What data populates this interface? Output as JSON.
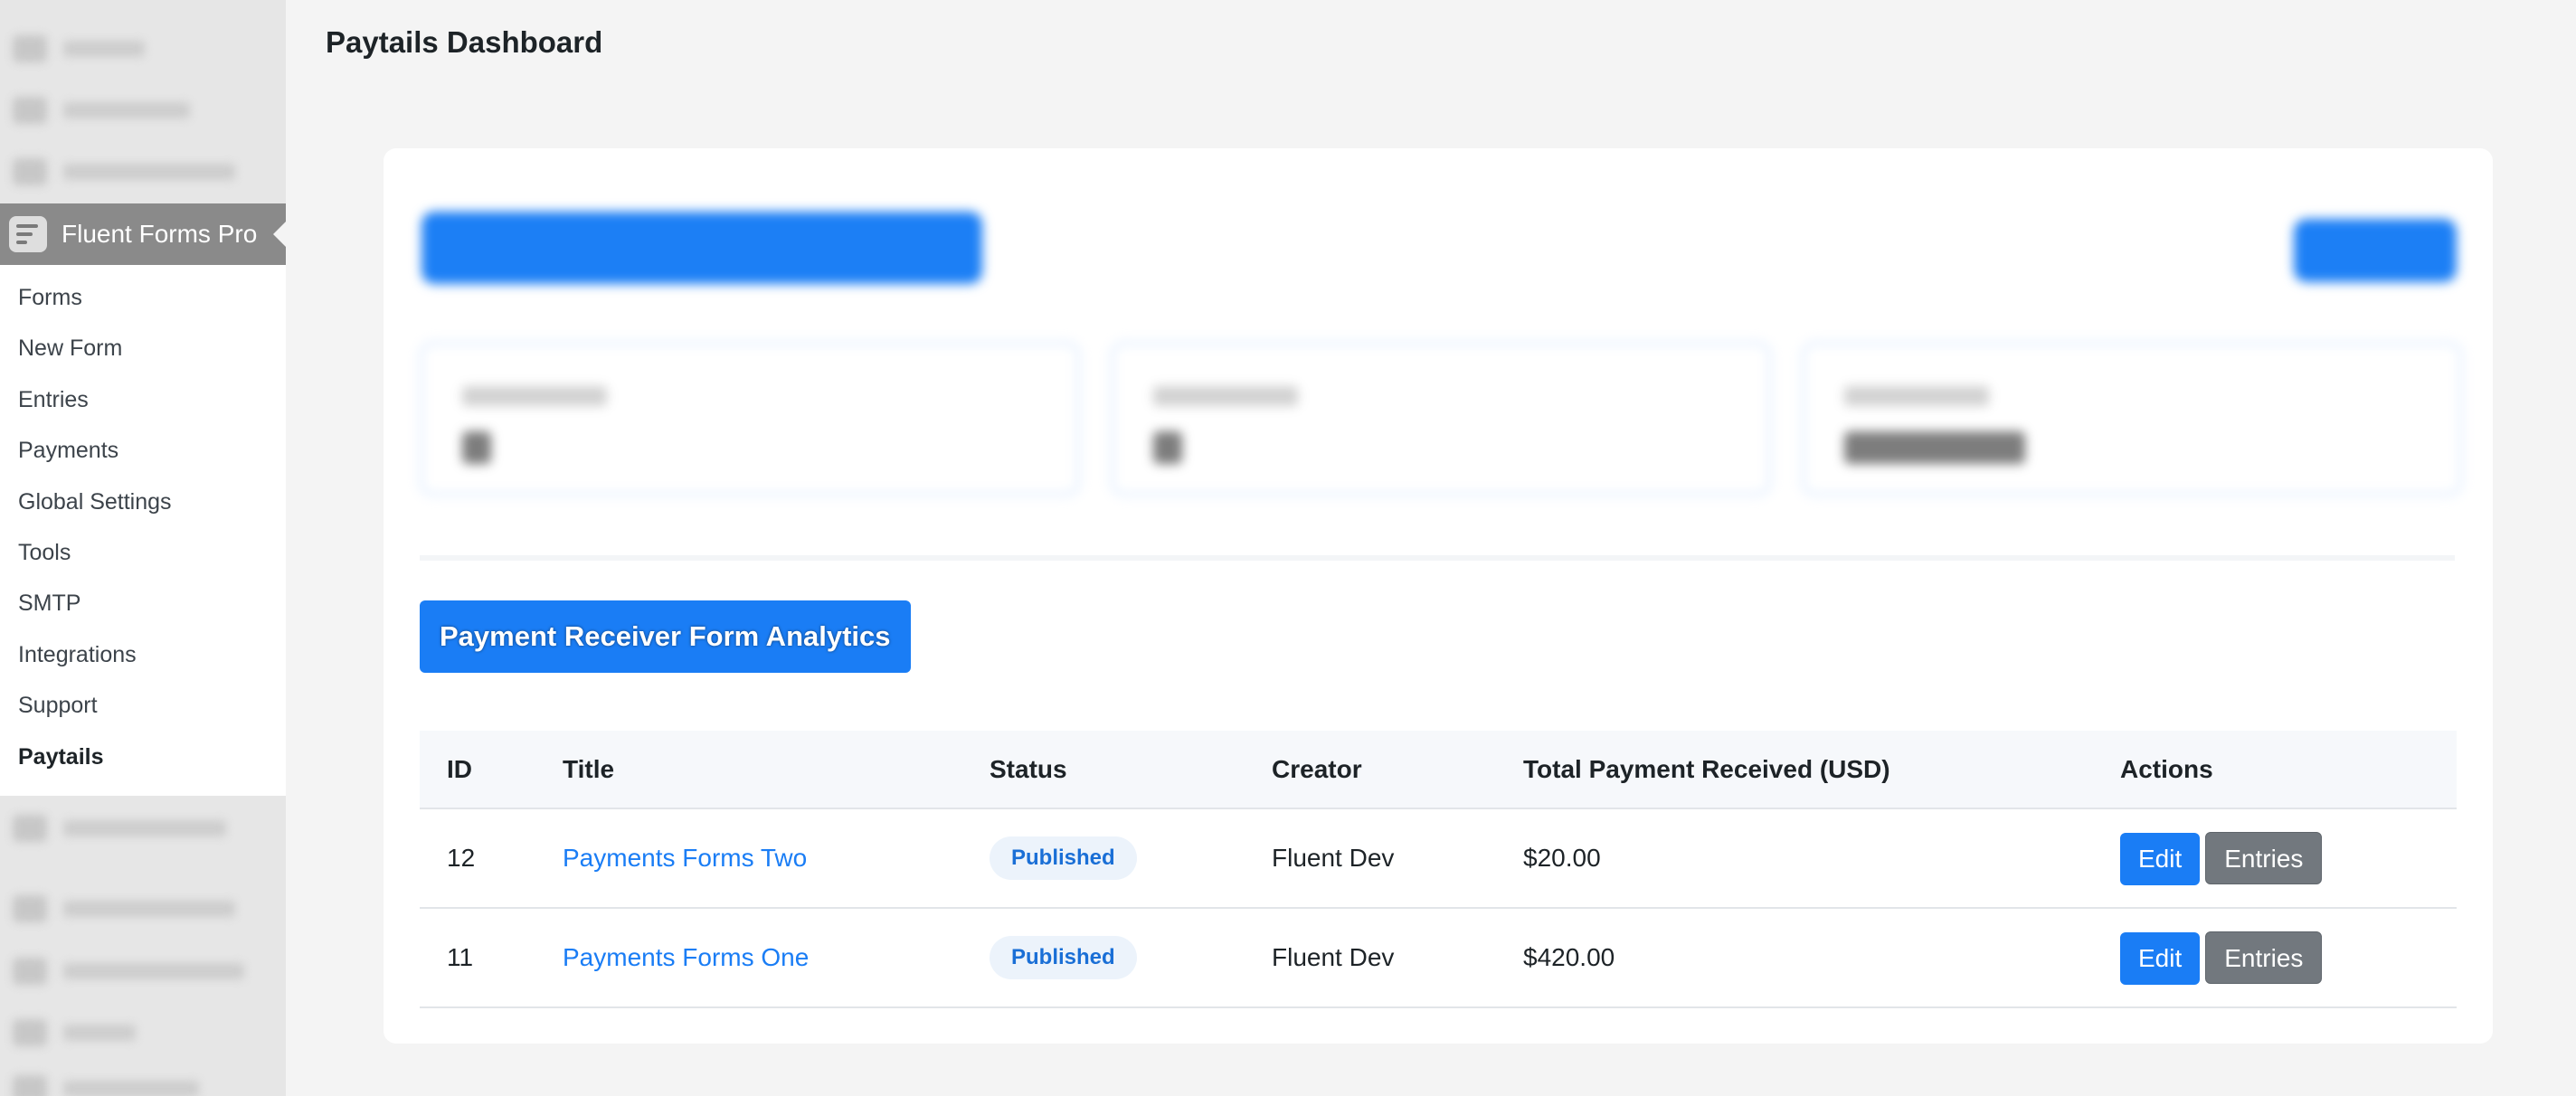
{
  "page_title": "Paytails Dashboard",
  "sidebar": {
    "plugin_title": "Fluent Forms Pro",
    "submenu": [
      {
        "label": "Forms"
      },
      {
        "label": "New Form"
      },
      {
        "label": "Entries"
      },
      {
        "label": "Payments"
      },
      {
        "label": "Global Settings"
      },
      {
        "label": "Tools"
      },
      {
        "label": "SMTP"
      },
      {
        "label": "Integrations"
      },
      {
        "label": "Support"
      },
      {
        "label": "Paytails"
      }
    ],
    "active_item": "Paytails"
  },
  "analytics_button": "Payment Receiver Form Analytics",
  "table": {
    "headers": {
      "id": "ID",
      "title": "Title",
      "status": "Status",
      "creator": "Creator",
      "total": "Total Payment Received (USD)",
      "actions": "Actions"
    },
    "rows": [
      {
        "id": "12",
        "title": "Payments Forms Two",
        "status": "Published",
        "creator": "Fluent Dev",
        "total": "$20.00"
      },
      {
        "id": "11",
        "title": "Payments Forms One",
        "status": "Published",
        "creator": "Fluent Dev",
        "total": "$420.00"
      }
    ],
    "edit_label": "Edit",
    "entries_label": "Entries"
  },
  "colors": {
    "primary": "#1a7df5",
    "secondary": "#72787e",
    "badge_bg": "#ecf3fb",
    "badge_text": "#1a6fd6"
  }
}
